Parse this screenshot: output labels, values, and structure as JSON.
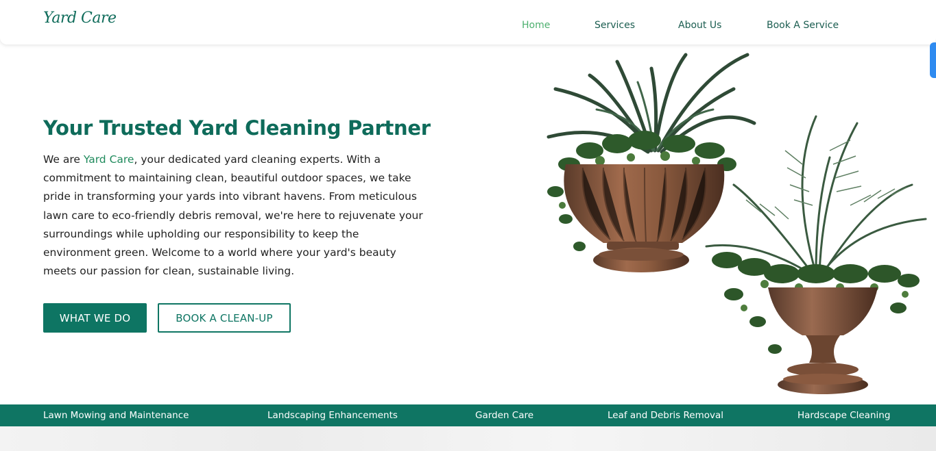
{
  "nav": {
    "logo": "Yard Care",
    "links": [
      {
        "label": "Home"
      },
      {
        "label": "Services"
      },
      {
        "label": "About Us"
      },
      {
        "label": "Book A Service"
      }
    ]
  },
  "hero": {
    "title": "Your Trusted Yard Cleaning Partner",
    "text_before": "We are ",
    "brand": "Yard Care",
    "text_after": ", your dedicated yard cleaning experts. With a commitment to maintaining clean, beautiful outdoor spaces, we take pride in transforming your yards into vibrant havens. From meticulous lawn care to eco-friendly debris removal, we're here to rejuvenate your surroundings while upholding our responsibility to keep the environment green. Welcome to a world where your yard's beauty meets our passion for clean, sustainable living.",
    "primary_button": "WHAT WE DO",
    "secondary_button": "BOOK A CLEAN-UP"
  },
  "services": [
    "Lawn Mowing and Maintenance",
    "Landscaping Enhancements",
    "Garden Care",
    "Leaf and Debris Removal",
    "Hardscape Cleaning"
  ],
  "colors": {
    "brand_green": "#0e7563",
    "active_nav": "#4caf6e",
    "side_tab": "#2f8bf0"
  }
}
